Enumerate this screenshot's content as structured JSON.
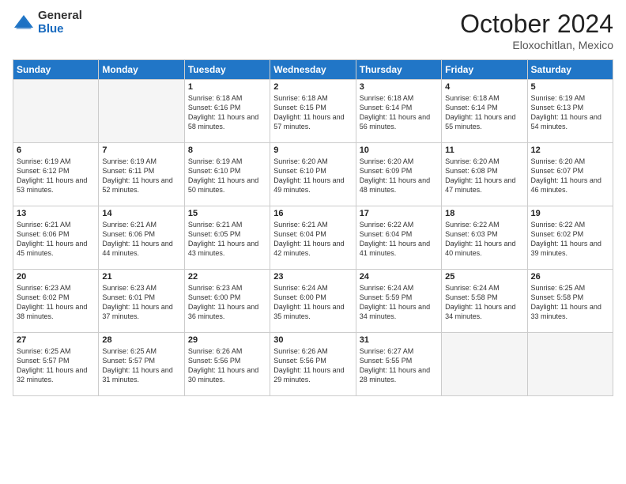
{
  "header": {
    "logo_general": "General",
    "logo_blue": "Blue",
    "month_title": "October 2024",
    "location": "Eloxochitlan, Mexico"
  },
  "days_of_week": [
    "Sunday",
    "Monday",
    "Tuesday",
    "Wednesday",
    "Thursday",
    "Friday",
    "Saturday"
  ],
  "weeks": [
    [
      {
        "day": "",
        "empty": true
      },
      {
        "day": "",
        "empty": true
      },
      {
        "day": "1",
        "sunrise": "Sunrise: 6:18 AM",
        "sunset": "Sunset: 6:16 PM",
        "daylight": "Daylight: 11 hours and 58 minutes."
      },
      {
        "day": "2",
        "sunrise": "Sunrise: 6:18 AM",
        "sunset": "Sunset: 6:15 PM",
        "daylight": "Daylight: 11 hours and 57 minutes."
      },
      {
        "day": "3",
        "sunrise": "Sunrise: 6:18 AM",
        "sunset": "Sunset: 6:14 PM",
        "daylight": "Daylight: 11 hours and 56 minutes."
      },
      {
        "day": "4",
        "sunrise": "Sunrise: 6:18 AM",
        "sunset": "Sunset: 6:14 PM",
        "daylight": "Daylight: 11 hours and 55 minutes."
      },
      {
        "day": "5",
        "sunrise": "Sunrise: 6:19 AM",
        "sunset": "Sunset: 6:13 PM",
        "daylight": "Daylight: 11 hours and 54 minutes."
      }
    ],
    [
      {
        "day": "6",
        "sunrise": "Sunrise: 6:19 AM",
        "sunset": "Sunset: 6:12 PM",
        "daylight": "Daylight: 11 hours and 53 minutes."
      },
      {
        "day": "7",
        "sunrise": "Sunrise: 6:19 AM",
        "sunset": "Sunset: 6:11 PM",
        "daylight": "Daylight: 11 hours and 52 minutes."
      },
      {
        "day": "8",
        "sunrise": "Sunrise: 6:19 AM",
        "sunset": "Sunset: 6:10 PM",
        "daylight": "Daylight: 11 hours and 50 minutes."
      },
      {
        "day": "9",
        "sunrise": "Sunrise: 6:20 AM",
        "sunset": "Sunset: 6:10 PM",
        "daylight": "Daylight: 11 hours and 49 minutes."
      },
      {
        "day": "10",
        "sunrise": "Sunrise: 6:20 AM",
        "sunset": "Sunset: 6:09 PM",
        "daylight": "Daylight: 11 hours and 48 minutes."
      },
      {
        "day": "11",
        "sunrise": "Sunrise: 6:20 AM",
        "sunset": "Sunset: 6:08 PM",
        "daylight": "Daylight: 11 hours and 47 minutes."
      },
      {
        "day": "12",
        "sunrise": "Sunrise: 6:20 AM",
        "sunset": "Sunset: 6:07 PM",
        "daylight": "Daylight: 11 hours and 46 minutes."
      }
    ],
    [
      {
        "day": "13",
        "sunrise": "Sunrise: 6:21 AM",
        "sunset": "Sunset: 6:06 PM",
        "daylight": "Daylight: 11 hours and 45 minutes."
      },
      {
        "day": "14",
        "sunrise": "Sunrise: 6:21 AM",
        "sunset": "Sunset: 6:06 PM",
        "daylight": "Daylight: 11 hours and 44 minutes."
      },
      {
        "day": "15",
        "sunrise": "Sunrise: 6:21 AM",
        "sunset": "Sunset: 6:05 PM",
        "daylight": "Daylight: 11 hours and 43 minutes."
      },
      {
        "day": "16",
        "sunrise": "Sunrise: 6:21 AM",
        "sunset": "Sunset: 6:04 PM",
        "daylight": "Daylight: 11 hours and 42 minutes."
      },
      {
        "day": "17",
        "sunrise": "Sunrise: 6:22 AM",
        "sunset": "Sunset: 6:04 PM",
        "daylight": "Daylight: 11 hours and 41 minutes."
      },
      {
        "day": "18",
        "sunrise": "Sunrise: 6:22 AM",
        "sunset": "Sunset: 6:03 PM",
        "daylight": "Daylight: 11 hours and 40 minutes."
      },
      {
        "day": "19",
        "sunrise": "Sunrise: 6:22 AM",
        "sunset": "Sunset: 6:02 PM",
        "daylight": "Daylight: 11 hours and 39 minutes."
      }
    ],
    [
      {
        "day": "20",
        "sunrise": "Sunrise: 6:23 AM",
        "sunset": "Sunset: 6:02 PM",
        "daylight": "Daylight: 11 hours and 38 minutes."
      },
      {
        "day": "21",
        "sunrise": "Sunrise: 6:23 AM",
        "sunset": "Sunset: 6:01 PM",
        "daylight": "Daylight: 11 hours and 37 minutes."
      },
      {
        "day": "22",
        "sunrise": "Sunrise: 6:23 AM",
        "sunset": "Sunset: 6:00 PM",
        "daylight": "Daylight: 11 hours and 36 minutes."
      },
      {
        "day": "23",
        "sunrise": "Sunrise: 6:24 AM",
        "sunset": "Sunset: 6:00 PM",
        "daylight": "Daylight: 11 hours and 35 minutes."
      },
      {
        "day": "24",
        "sunrise": "Sunrise: 6:24 AM",
        "sunset": "Sunset: 5:59 PM",
        "daylight": "Daylight: 11 hours and 34 minutes."
      },
      {
        "day": "25",
        "sunrise": "Sunrise: 6:24 AM",
        "sunset": "Sunset: 5:58 PM",
        "daylight": "Daylight: 11 hours and 34 minutes."
      },
      {
        "day": "26",
        "sunrise": "Sunrise: 6:25 AM",
        "sunset": "Sunset: 5:58 PM",
        "daylight": "Daylight: 11 hours and 33 minutes."
      }
    ],
    [
      {
        "day": "27",
        "sunrise": "Sunrise: 6:25 AM",
        "sunset": "Sunset: 5:57 PM",
        "daylight": "Daylight: 11 hours and 32 minutes."
      },
      {
        "day": "28",
        "sunrise": "Sunrise: 6:25 AM",
        "sunset": "Sunset: 5:57 PM",
        "daylight": "Daylight: 11 hours and 31 minutes."
      },
      {
        "day": "29",
        "sunrise": "Sunrise: 6:26 AM",
        "sunset": "Sunset: 5:56 PM",
        "daylight": "Daylight: 11 hours and 30 minutes."
      },
      {
        "day": "30",
        "sunrise": "Sunrise: 6:26 AM",
        "sunset": "Sunset: 5:56 PM",
        "daylight": "Daylight: 11 hours and 29 minutes."
      },
      {
        "day": "31",
        "sunrise": "Sunrise: 6:27 AM",
        "sunset": "Sunset: 5:55 PM",
        "daylight": "Daylight: 11 hours and 28 minutes."
      },
      {
        "day": "",
        "empty": true
      },
      {
        "day": "",
        "empty": true
      }
    ]
  ]
}
